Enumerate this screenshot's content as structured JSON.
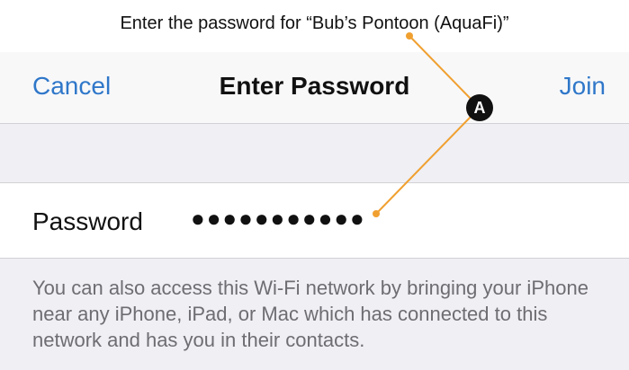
{
  "prompt": "Enter the password for “Bub’s Pontoon (AquaFi)”",
  "navbar": {
    "cancel_label": "Cancel",
    "title": "Enter Password",
    "join_label": "Join"
  },
  "password_field": {
    "label": "Password",
    "value": "●●●●●●●●●●●"
  },
  "footer_text": "You can also access this Wi-Fi network by bringing your iPhone near any iPhone, iPad, or Mac which has connected to this network and has you in their contacts.",
  "annotation": {
    "badge": "A"
  },
  "colors": {
    "accent": "#2f77c9",
    "callout_line": "#f0a030"
  }
}
